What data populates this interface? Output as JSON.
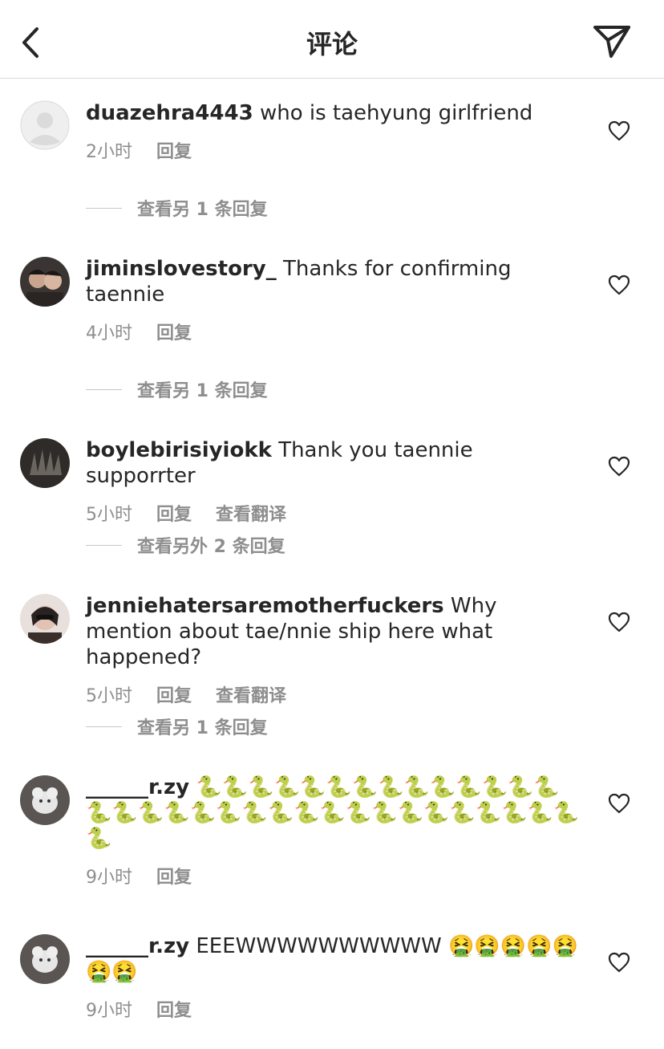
{
  "header": {
    "title": "评论"
  },
  "comments": [
    {
      "username": "duazehra4443",
      "text": "who is taehyung girlfriend",
      "time": "2小时",
      "reply": "回复",
      "translate": "",
      "view_replies": "查看另 1 条回复"
    },
    {
      "username": "jiminslovestory_",
      "text": "Thanks for confirming taennie",
      "time": "4小时",
      "reply": "回复",
      "translate": "",
      "view_replies": "查看另 1 条回复"
    },
    {
      "username": "boylebirisiyiokk",
      "text": "Thank you taennie supporrter",
      "time": "5小时",
      "reply": "回复",
      "translate": "查看翻译",
      "view_replies": "查看另外 2 条回复"
    },
    {
      "username": "jenniehatersaremotherfuckers",
      "text": "Why mention about tae/nnie ship here what happened?",
      "time": "5小时",
      "reply": "回复",
      "translate": "查看翻译",
      "view_replies": "查看另 1 条回复"
    },
    {
      "username": "______r.zy",
      "text": "🐍🐍🐍🐍🐍🐍🐍🐍🐍🐍🐍🐍🐍🐍🐍🐍🐍🐍🐍🐍🐍🐍🐍🐍🐍🐍🐍🐍🐍🐍🐍🐍🐍🐍",
      "time": "9小时",
      "reply": "回复",
      "translate": "",
      "view_replies": ""
    },
    {
      "username": "______r.zy",
      "text": "EEEWWWWWWWWWW 🤮🤮🤮🤮🤮🤮🤮",
      "time": "9小时",
      "reply": "回复",
      "translate": "",
      "view_replies": ""
    }
  ],
  "icons": {
    "back": "chevron-left-icon",
    "share": "paper-plane-icon",
    "like": "heart-outline-icon"
  }
}
